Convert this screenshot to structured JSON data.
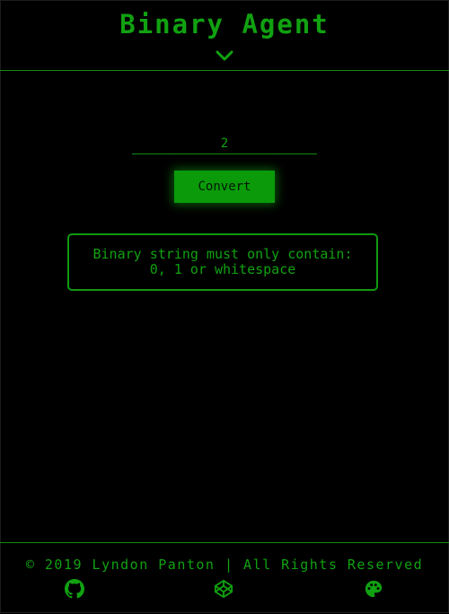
{
  "header": {
    "title": "Binary Agent",
    "toggle_icon": "chevron-down-icon"
  },
  "converter": {
    "input_value": "2",
    "button_label": "Convert",
    "result_message": "Binary string must only contain: 0, 1 or whitespace"
  },
  "footer": {
    "copyright": "© 2019 Lyndon Panton | All Rights Reserved",
    "icons": [
      "github-icon",
      "codepen-icon",
      "palette-icon"
    ]
  },
  "colors": {
    "accent": "#11a111",
    "background": "#000000",
    "button": "#0a9a0a"
  }
}
